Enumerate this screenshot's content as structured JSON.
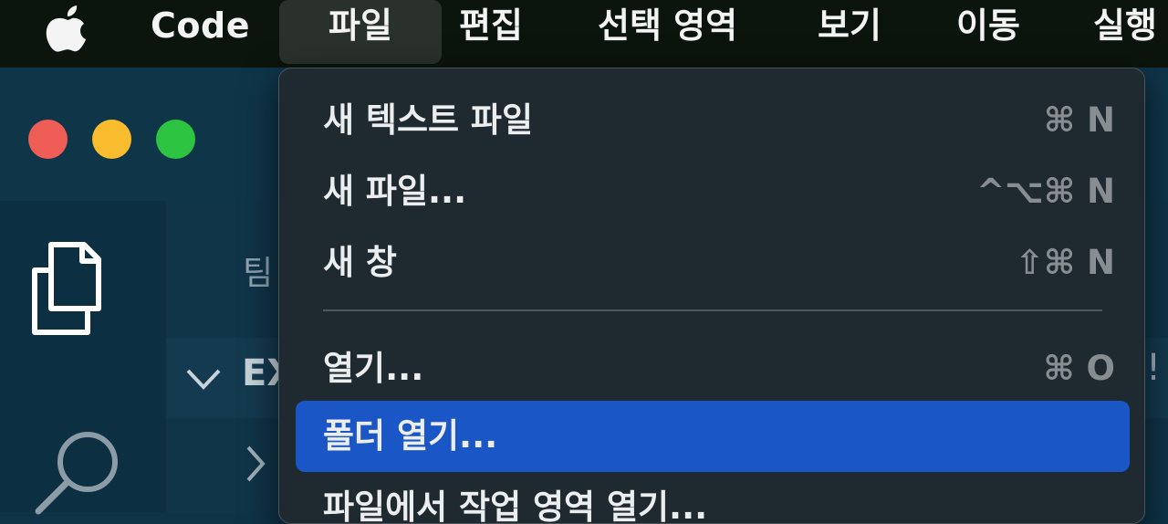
{
  "menubar": {
    "apple_icon": "apple-logo-icon",
    "app_name": "Code",
    "menus": [
      "파일",
      "편집",
      "선택 영역",
      "보기",
      "이동",
      "실행"
    ]
  },
  "window": {
    "traffic_lights": {
      "close_color": "#ee5e57",
      "minimize_color": "#f8bc2e",
      "zoom_color": "#2dc441"
    },
    "activity_bar": {
      "icons": [
        "files-icon",
        "search-icon"
      ]
    },
    "sidebar": {
      "title_fragment": "팀",
      "section_fragment": "EX",
      "right_edge_fragment": "!"
    }
  },
  "file_menu": {
    "items": [
      {
        "label": "새 텍스트 파일",
        "shortcut": "⌘ N"
      },
      {
        "label": "새 파일...",
        "shortcut": "^⌥⌘ N"
      },
      {
        "label": "새 창",
        "shortcut": "⇧⌘ N"
      },
      {
        "label": "열기...",
        "shortcut": "⌘ O"
      },
      {
        "label": "폴더 열기...",
        "shortcut": ""
      },
      {
        "label": "파일에서 작업 영역 열기...",
        "shortcut": ""
      }
    ],
    "highlighted_item": "폴더 열기...",
    "highlight_color": "#1a56c6"
  }
}
